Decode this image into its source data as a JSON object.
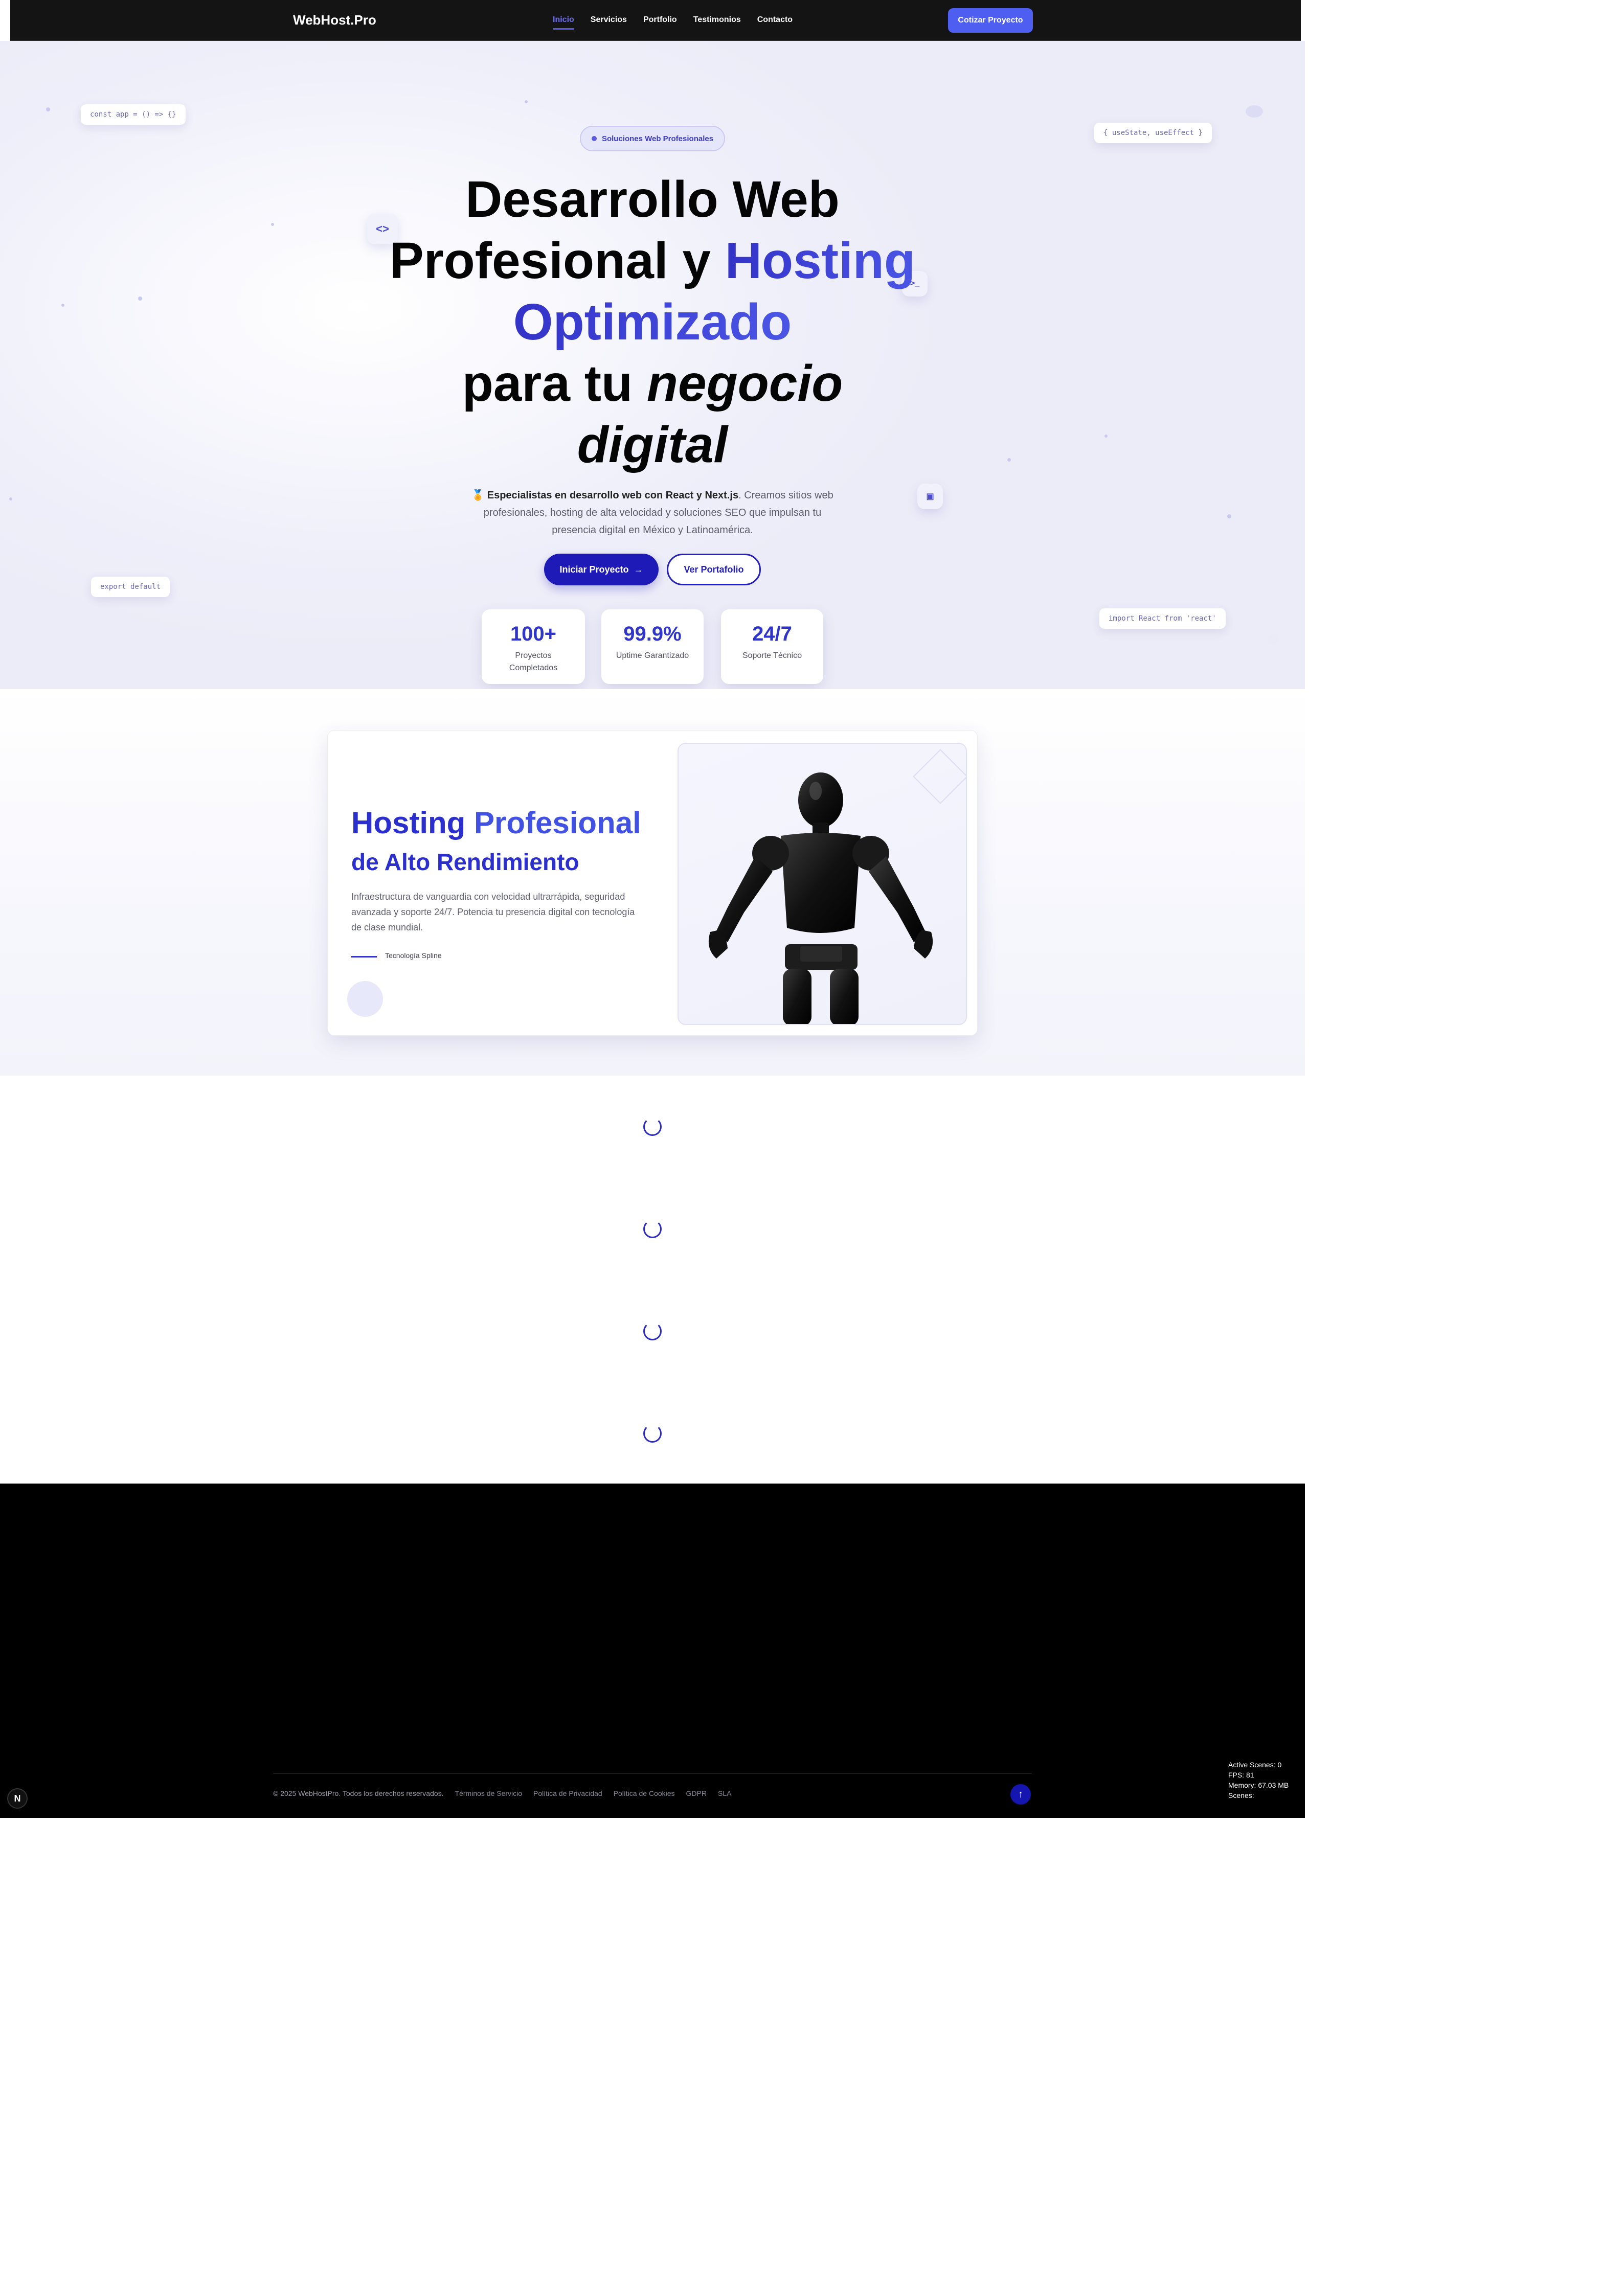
{
  "nav": {
    "brand": "WebHost.Pro",
    "items": [
      "Inicio",
      "Servicios",
      "Portfolio",
      "Testimonios",
      "Contacto"
    ],
    "active_item": "Inicio",
    "cta_label": "Cotizar Proyecto"
  },
  "hero": {
    "badge": "Soluciones Web Profesionales",
    "title": {
      "line1": "Desarrollo Web",
      "line2_plain": "Profesional y",
      "line2_accent": "Hosting",
      "line3_accent": "Optimizado",
      "line4_plain": "para tu",
      "line4_italic": "negocio",
      "line5_italic": "digital"
    },
    "subtitle_emoji": "🏅",
    "subtitle_bold": "Especialistas en desarrollo web con React y Next.js",
    "subtitle_rest": ". Creamos sitios web profesionales, hosting de alta velocidad y soluciones SEO que impulsan tu presencia digital en México y Latinoamérica.",
    "primary_cta": "Iniciar Proyecto",
    "primary_cta_icon": "→",
    "secondary_cta": "Ver Portafolio",
    "stats": [
      {
        "value": "100+",
        "label_line1": "Proyectos",
        "label_line2": "Completados"
      },
      {
        "value": "99.9%",
        "label_line1": "Uptime Garantizado",
        "label_line2": ""
      },
      {
        "value": "24/7",
        "label_line1": "Soporte Técnico",
        "label_line2": ""
      }
    ],
    "code_chips": {
      "top_left": "const app = () => {}",
      "top_right": "{ useState, useEffect }",
      "bottom_left": "export default",
      "bottom_right": "import React from 'react'"
    },
    "float_icons": {
      "code": "<>",
      "terminal": ">_",
      "chip": "▣"
    }
  },
  "hosting": {
    "title_plain": "Hosting",
    "title_accent": "Profesional",
    "subtitle": "de Alto Rendimiento",
    "description": "Infraestructura de vanguardia con velocidad ultrarrápida, seguridad avanzada y soporte 24/7. Potencia tu presencia digital con tecnología de clase mundial.",
    "tech_label": "Tecnología Spline",
    "image_icon": "robot-3d-figure"
  },
  "footer": {
    "copyright": "© 2025 WebHostPro. Todos los derechos reservados.",
    "links": [
      "Términos de Servicio",
      "Política de Privacidad",
      "Política de Cookies",
      "GDPR",
      "SLA"
    ],
    "back_to_top_icon": "↑"
  },
  "overlay": {
    "active_scenes": "Active Scenes: 0",
    "fps": "FPS: 81",
    "memory": "Memory: 67.03 MB",
    "scenes": "Scenes:"
  },
  "colors": {
    "accent": "#2b2fcd",
    "accent_light": "#4e5ef0",
    "nav_bg": "#141414",
    "footer_bg": "#000000"
  }
}
